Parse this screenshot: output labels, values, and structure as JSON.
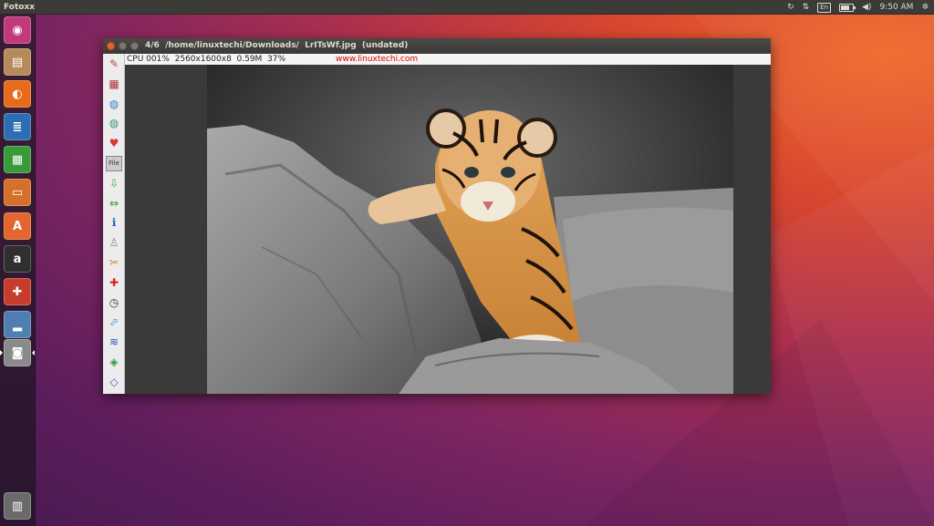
{
  "top_panel": {
    "app_name": "Fotoxx",
    "keyboard_layout": "En",
    "clock": "9:50 AM",
    "icons": [
      "ubuntu-one-sync-icon",
      "network-updown-icon",
      "keyboard-icon",
      "battery-icon",
      "volume-icon",
      "settings-gear-icon"
    ]
  },
  "launcher": {
    "items": [
      {
        "name": "dash-home",
        "glyph": "◉",
        "color": "#c23a7b"
      },
      {
        "name": "files",
        "glyph": "▤",
        "color": "#b68a5a"
      },
      {
        "name": "firefox",
        "glyph": "◐",
        "color": "#e86a1b"
      },
      {
        "name": "libreoffice-writer",
        "glyph": "≣",
        "color": "#2d6db5"
      },
      {
        "name": "libreoffice-calc",
        "glyph": "▦",
        "color": "#3a9a3a"
      },
      {
        "name": "libreoffice-impress",
        "glyph": "▭",
        "color": "#d5702a"
      },
      {
        "name": "ubuntu-software",
        "glyph": "A",
        "color": "#e2662e"
      },
      {
        "name": "amazon",
        "glyph": "a",
        "color": "#2f2f2f"
      },
      {
        "name": "system-settings",
        "glyph": "✚",
        "color": "#c73c2c"
      },
      {
        "name": "installer",
        "glyph": "▂",
        "color": "#4f7fb0"
      },
      {
        "name": "fotoxx",
        "glyph": "◙",
        "color": "#8a8a8a"
      },
      {
        "name": "trash",
        "glyph": "▥",
        "color": "#6a6a6a"
      }
    ]
  },
  "window": {
    "title": "4/6  /home/linuxtechi/Downloads/  LrITsWf.jpg  (undated)",
    "status": "CPU 001%  2560x1600x8  0.59M  37%",
    "watermark_url": "www.linuxtechi.com",
    "tools": [
      {
        "name": "edit-tool",
        "glyph": "✎",
        "color": "#b44"
      },
      {
        "name": "gallery-tool",
        "glyph": "▦",
        "color": "#a33"
      },
      {
        "name": "globe-tool",
        "glyph": "◍",
        "color": "#3a7bd5"
      },
      {
        "name": "world-map-tool",
        "glyph": "◍",
        "color": "#3a9a6a"
      },
      {
        "name": "favorite-tool",
        "glyph": "♥",
        "color": "#d33"
      },
      {
        "name": "file-tool",
        "glyph": "File",
        "color": "#333"
      },
      {
        "name": "save-tool",
        "glyph": "⇩",
        "color": "#4a4"
      },
      {
        "name": "prev-next-tool",
        "glyph": "⇔",
        "color": "#1a9a2a"
      },
      {
        "name": "info-tool",
        "glyph": "ℹ",
        "color": "#1f5fc5"
      },
      {
        "name": "select-tool",
        "glyph": "♙",
        "color": "#888"
      },
      {
        "name": "retouch-tool",
        "glyph": "✂",
        "color": "#c88a1a"
      },
      {
        "name": "repair-tool",
        "glyph": "✚",
        "color": "#d22"
      },
      {
        "name": "clock-tool",
        "glyph": "◷",
        "color": "#333"
      },
      {
        "name": "warp-tool",
        "glyph": "⬀",
        "color": "#3a8ad5"
      },
      {
        "name": "layers-tool",
        "glyph": "≋",
        "color": "#1f55b5"
      },
      {
        "name": "batch-tool",
        "glyph": "◈",
        "color": "#2a9a3a"
      },
      {
        "name": "more-tool",
        "glyph": "◇",
        "color": "#3a6ab5"
      }
    ]
  },
  "colors": {
    "panel": "#3c3b37",
    "close_button": "#e9602f",
    "watermark": "#dd0000"
  }
}
